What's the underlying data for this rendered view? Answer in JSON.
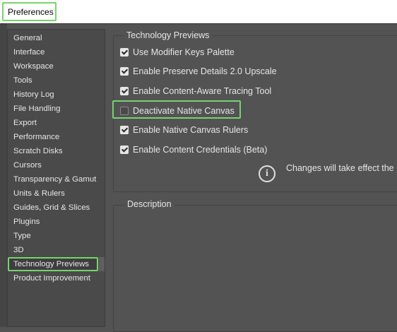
{
  "window": {
    "title": "Preferences"
  },
  "sidebar": {
    "items": [
      {
        "label": "General"
      },
      {
        "label": "Interface"
      },
      {
        "label": "Workspace"
      },
      {
        "label": "Tools"
      },
      {
        "label": "History Log"
      },
      {
        "label": "File Handling"
      },
      {
        "label": "Export"
      },
      {
        "label": "Performance"
      },
      {
        "label": "Scratch Disks"
      },
      {
        "label": "Cursors"
      },
      {
        "label": "Transparency & Gamut"
      },
      {
        "label": "Units & Rulers"
      },
      {
        "label": "Guides, Grid & Slices"
      },
      {
        "label": "Plugins"
      },
      {
        "label": "Type"
      },
      {
        "label": "3D"
      },
      {
        "label": "Technology Previews"
      },
      {
        "label": "Product Improvement"
      }
    ],
    "selected_label": "Technology Previews"
  },
  "tech_previews": {
    "heading": "Technology Previews",
    "options": [
      {
        "label": "Use Modifier Keys Palette",
        "checked": true
      },
      {
        "label": "Enable Preserve Details 2.0 Upscale",
        "checked": true
      },
      {
        "label": "Enable Content-Aware Tracing Tool",
        "checked": true
      },
      {
        "label": "Deactivate Native Canvas",
        "checked": false
      },
      {
        "label": "Enable Native Canvas Rulers",
        "checked": true
      },
      {
        "label": "Enable Content Credentials (Beta)",
        "checked": true
      }
    ],
    "info_icon": "info-icon",
    "info_text": "Changes will take effect the"
  },
  "description": {
    "heading": "Description"
  },
  "colors": {
    "highlight": "#77d36d",
    "panel_bg": "#535353",
    "sidebar_bg": "#4a4a4a"
  }
}
